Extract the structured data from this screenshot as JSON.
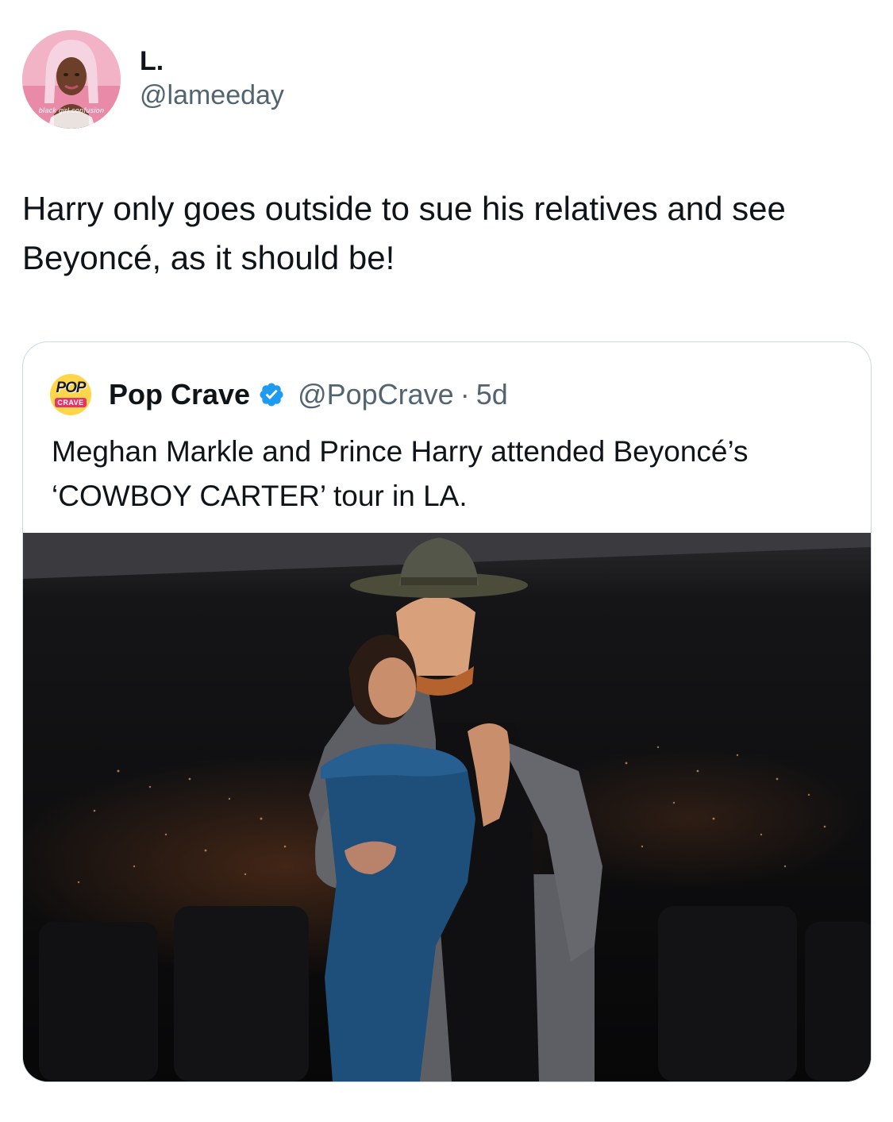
{
  "tweet": {
    "author": {
      "display_name": "L.",
      "handle": "@lameeday",
      "avatar_icon": "profile-avatar",
      "avatar_caption": "black girl confusion"
    },
    "text": "Harry only goes outside to sue his relatives and see Beyoncé, as it should be!"
  },
  "quoted_tweet": {
    "author": {
      "display_name": "Pop Crave",
      "verified": true,
      "handle": "@PopCrave",
      "avatar_logo": {
        "line1": "POP",
        "line2": "CRAVE"
      }
    },
    "separator": "·",
    "time": "5d",
    "text": "Meghan Markle and Prince Harry attended Beyoncé’s ‘COWBOY CARTER’ tour in LA.",
    "media": {
      "type": "photo",
      "description_icon": "photo-couple-at-concert"
    }
  },
  "colors": {
    "text_primary": "#0f1419",
    "text_secondary": "#536471",
    "border": "#cfd9de",
    "verified_blue": "#1d9bf0",
    "pop_crave_yellow": "#ffd54a",
    "pop_crave_pink": "#e8336a"
  }
}
